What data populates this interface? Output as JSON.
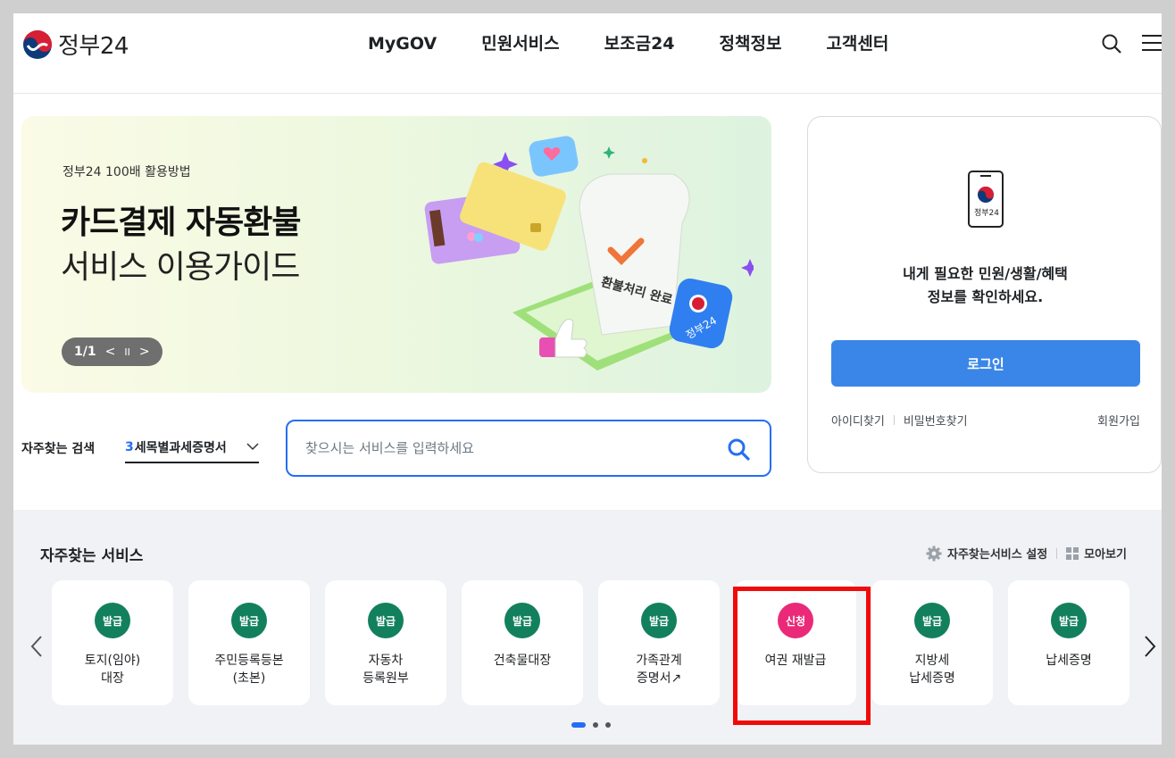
{
  "header": {
    "logo_text": "정부24",
    "nav": [
      {
        "label": "MyGOV",
        "name": "nav-mygov"
      },
      {
        "label": "민원서비스",
        "name": "nav-civil-service"
      },
      {
        "label": "보조금24",
        "name": "nav-subsidy24"
      },
      {
        "label": "정책정보",
        "name": "nav-policy-info"
      },
      {
        "label": "고객센터",
        "name": "nav-customer-center"
      }
    ]
  },
  "banner": {
    "eyebrow": "정부24 100배 활용방법",
    "title_bold": "카드결제 자동환불",
    "title_light": "서비스 이용가이드",
    "pager": "1/1",
    "art_text_receipt": "환불처리 완료",
    "art_text_badge": "정부24"
  },
  "search": {
    "label": "자주찾는 검색",
    "selected_num": "3",
    "selected_text": "세목별과세증명서",
    "placeholder": "찾으시는 서비스를 입력하세요"
  },
  "login": {
    "phone_label": "정부24",
    "message_line1": "내게 필요한 민원/생활/혜택",
    "message_line2": "정보를 확인하세요.",
    "button": "로그인",
    "link_find_id": "아이디찾기",
    "link_find_pw": "비밀번호찾기",
    "link_join": "회원가입"
  },
  "services": {
    "title": "자주찾는 서비스",
    "settings_label": "자주찾는서비스 설정",
    "view_all_label": "모아보기",
    "cards": [
      {
        "badge": "발급",
        "label": "토지(임야)\n대장",
        "badge_color": "#12805c"
      },
      {
        "badge": "발급",
        "label": "주민등록등본\n(초본)",
        "badge_color": "#12805c"
      },
      {
        "badge": "발급",
        "label": "자동차\n등록원부",
        "badge_color": "#12805c"
      },
      {
        "badge": "발급",
        "label": "건축물대장",
        "badge_color": "#12805c"
      },
      {
        "badge": "발급",
        "label": "가족관계\n증명서↗",
        "badge_color": "#12805c"
      },
      {
        "badge": "신청",
        "label": "여권 재발급",
        "badge_color": "#ea2a78"
      },
      {
        "badge": "발급",
        "label": "지방세\n납세증명",
        "badge_color": "#12805c"
      },
      {
        "badge": "발급",
        "label": "납세증명",
        "badge_color": "#12805c"
      }
    ]
  },
  "colors": {
    "primary_blue": "#256ef4",
    "login_button": "#3a86e8",
    "badge_green": "#12805c",
    "badge_pink": "#ea2a78",
    "highlight_red": "#f00a0a"
  }
}
